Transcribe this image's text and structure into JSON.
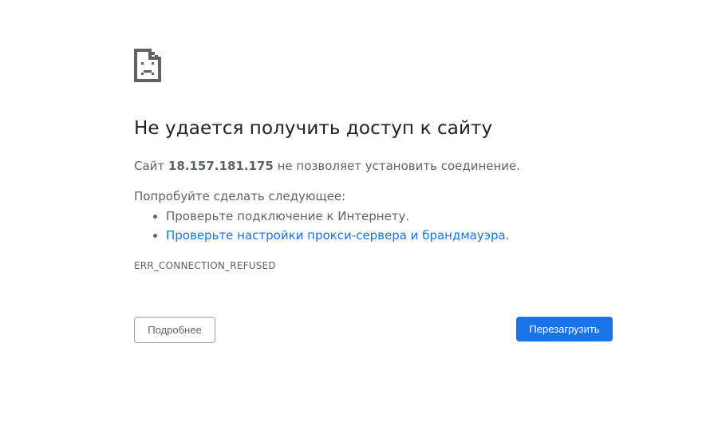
{
  "icon": "sad-page-icon",
  "title": "Не удается получить доступ к сайту",
  "description": {
    "prefix": "Сайт ",
    "host": "18.157.181.175",
    "suffix": " не позволяет установить соединение."
  },
  "suggestions": {
    "label": "Попробуйте сделать следующее:",
    "items": [
      {
        "text": "Проверьте подключение к Интернету.",
        "link": ""
      },
      {
        "text": "",
        "link": "Проверьте настройки прокси-сервера и брандмауэра",
        "trail": "."
      }
    ]
  },
  "error_code": "ERR_CONNECTION_REFUSED",
  "buttons": {
    "details": "Подробнее",
    "reload": "Перезагрузить"
  },
  "colors": {
    "title": "#202124",
    "text": "#5f6368",
    "link": "#1a73e8",
    "primary": "#1a73e8"
  }
}
